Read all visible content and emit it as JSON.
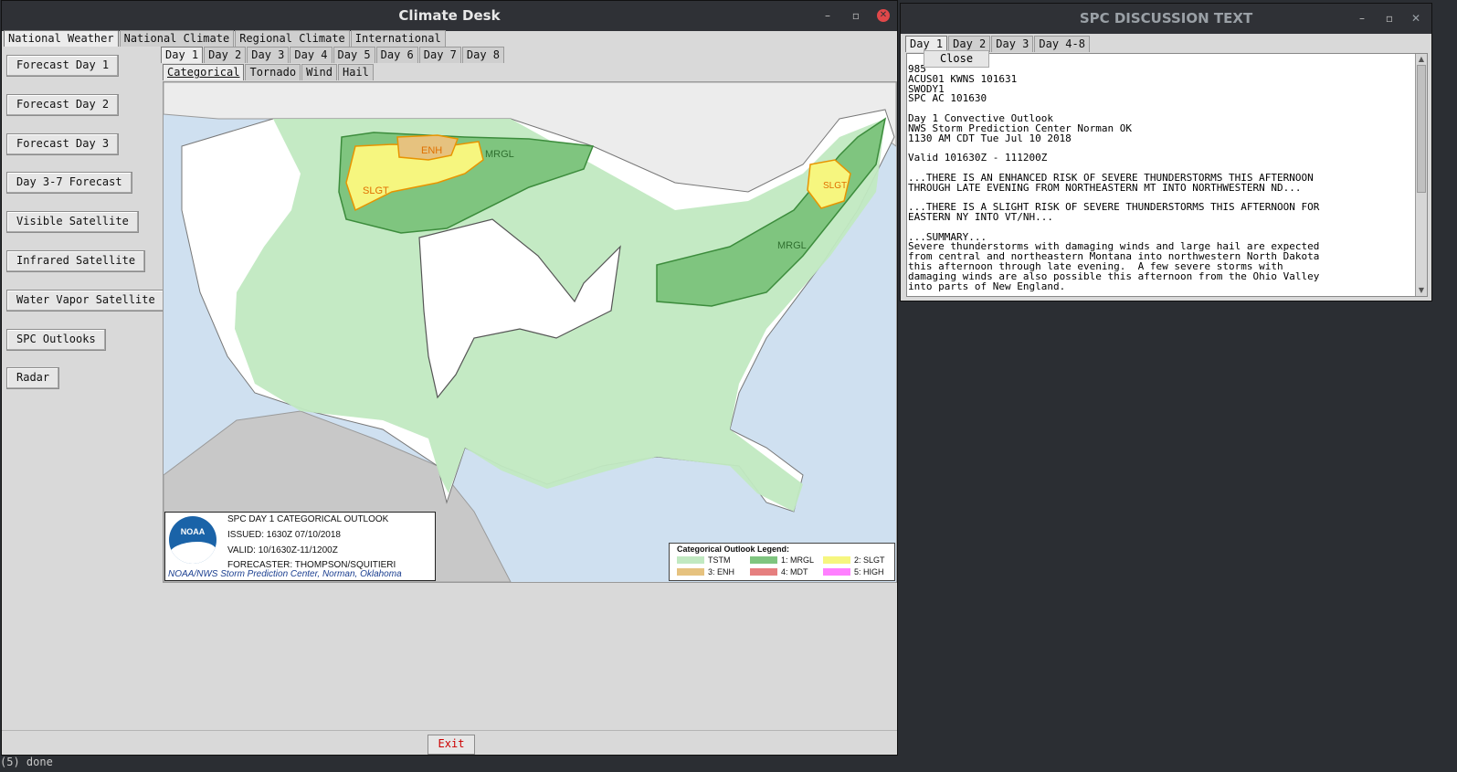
{
  "climate_window": {
    "title": "Climate Desk",
    "controls": {
      "minimize": "–",
      "restore": "▫",
      "close": "✕"
    },
    "top_tabs": [
      "National Weather",
      "National Climate",
      "Regional Climate",
      "International"
    ],
    "left_buttons": [
      "Forecast Day 1",
      "Forecast Day 2",
      "Forecast Day 3",
      "Day 3-7 Forecast",
      "Visible Satellite",
      "Infrared Satellite",
      "Water Vapor Satellite",
      "SPC Outlooks",
      "Radar"
    ],
    "day_tabs": [
      "Day 1",
      "Day 2",
      "Day 3",
      "Day 4",
      "Day 5",
      "Day 6",
      "Day 7",
      "Day 8"
    ],
    "type_tabs": [
      "Categorical",
      "Tornado",
      "Wind",
      "Hail"
    ],
    "map": {
      "labels": {
        "enh": "ENH",
        "slgt_west": "SLGT",
        "mrgl_north": "MRGL",
        "mrgl_east": "MRGL",
        "slgt_east": "SLGT"
      },
      "logo_text": "NOAA",
      "info": {
        "title": "SPC DAY 1 CATEGORICAL OUTLOOK",
        "issued": "ISSUED: 1630Z 07/10/2018",
        "valid": "VALID: 10/1630Z-11/1200Z",
        "forecaster": "FORECASTER: THOMPSON/SQUITIERI",
        "footer": "NOAA/NWS Storm Prediction Center, Norman, Oklahoma"
      },
      "legend": {
        "title": "Categorical Outlook Legend:",
        "items": [
          {
            "label": "TSTM",
            "color": "#c1e9c1"
          },
          {
            "label": "1: MRGL",
            "color": "#7fc57f"
          },
          {
            "label": "2: SLGT",
            "color": "#f6f67f"
          },
          {
            "label": "3: ENH",
            "color": "#e6c27f"
          },
          {
            "label": "4: MDT",
            "color": "#e67f7f"
          },
          {
            "label": "5: HIGH",
            "color": "#ff7fff"
          }
        ]
      }
    },
    "exit_label": "Exit"
  },
  "spc_window": {
    "title": "SPC DISCUSSION TEXT",
    "controls": {
      "minimize": "–",
      "restore": "▫",
      "close": "✕"
    },
    "tabs": [
      "Day 1",
      "Day 2",
      "Day 3",
      "Day 4-8"
    ],
    "close_label": "Close",
    "text": "985\nACUS01 KWNS 101631\nSWODY1\nSPC AC 101630\n\nDay 1 Convective Outlook\nNWS Storm Prediction Center Norman OK\n1130 AM CDT Tue Jul 10 2018\n\nValid 101630Z - 111200Z\n\n...THERE IS AN ENHANCED RISK OF SEVERE THUNDERSTORMS THIS AFTERNOON\nTHROUGH LATE EVENING FROM NORTHEASTERN MT INTO NORTHWESTERN ND...\n\n...THERE IS A SLIGHT RISK OF SEVERE THUNDERSTORMS THIS AFTERNOON FOR\nEASTERN NY INTO VT/NH...\n\n...SUMMARY...\nSevere thunderstorms with damaging winds and large hail are expected\nfrom central and northeastern Montana into northwestern North Dakota\nthis afternoon through late evening.  A few severe storms with\ndamaging winds are also possible this afternoon from the Ohio Valley\ninto parts of New England."
  },
  "terminal_text": "(5)  done",
  "colors": {
    "accent_red": "#e0484a",
    "titlebar": "#2f3136"
  }
}
